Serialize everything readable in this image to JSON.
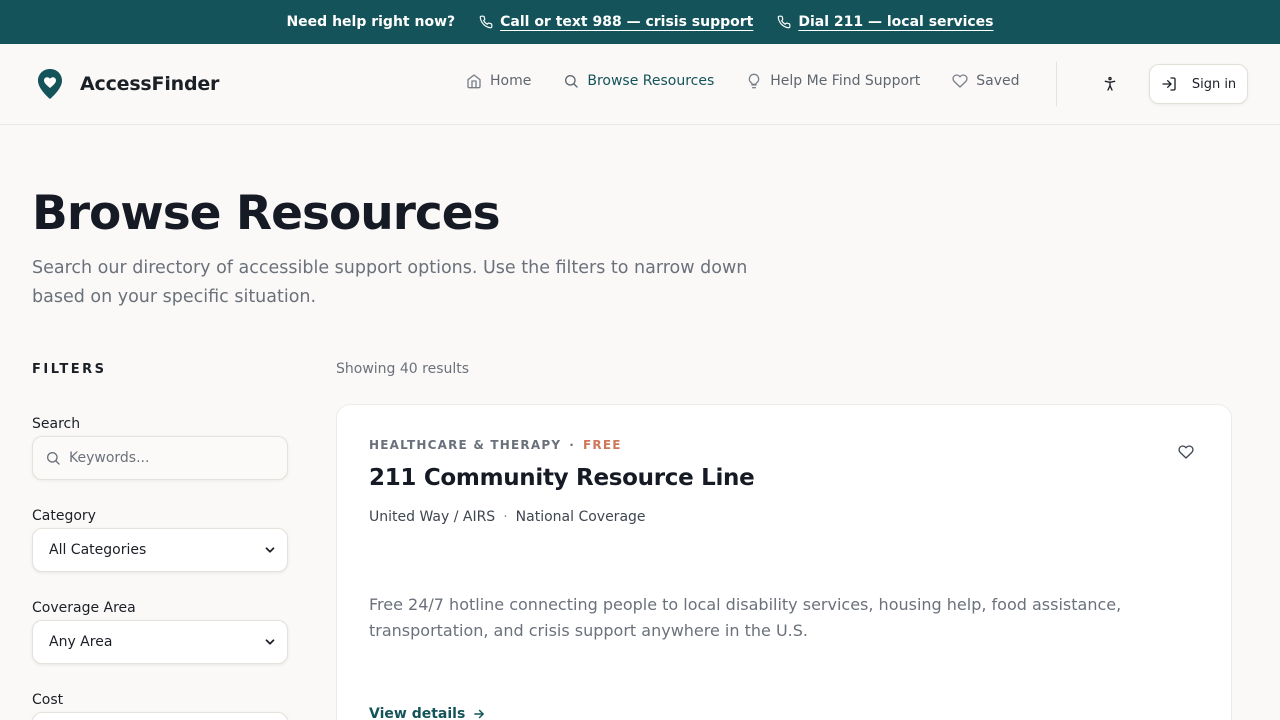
{
  "crisis_bar": {
    "lead_text": "Need help right now?",
    "links": [
      {
        "label": "Call or text 988 — crisis support",
        "icon": "phone-icon"
      },
      {
        "label": "Dial 211 — local services",
        "icon": "phone-icon"
      }
    ]
  },
  "header": {
    "brand_name": "AccessFinder",
    "logo_icon": "map-pin-icon",
    "nav": [
      {
        "label": "Home",
        "icon": "home-icon",
        "active": false
      },
      {
        "label": "Browse Resources",
        "icon": "search-icon",
        "active": true
      },
      {
        "label": "Help Me Find Support",
        "icon": "lightbulb-icon",
        "active": false
      },
      {
        "label": "Saved",
        "icon": "heart-icon",
        "active": false
      }
    ],
    "accessibility_icon": "accessibility-icon",
    "signin_label": "Sign in",
    "signin_icon": "sign-in-icon"
  },
  "hero": {
    "title": "Browse Resources",
    "subtitle": "Search our directory of accessible support options. Use the filters to narrow down based on your specific situation."
  },
  "filters": {
    "heading": "FILTERS",
    "search": {
      "label": "Search",
      "placeholder": "Keywords...",
      "value": ""
    },
    "category": {
      "label": "Category",
      "selected": "All Categories"
    },
    "coverage": {
      "label": "Coverage Area",
      "selected": "Any Area"
    },
    "cost": {
      "label": "Cost"
    }
  },
  "results": {
    "count_text": "Showing 40 results",
    "items": [
      {
        "category": "HEALTHCARE & THERAPY",
        "cost_badge": "FREE",
        "title": "211 Community Resource Line",
        "provider": "United Way / AIRS",
        "coverage": "National Coverage",
        "description": "Free 24/7 hotline connecting people to local disability services, housing help, food assistance, transportation, and crisis support anywhere in the U.S.",
        "link_label": "View details"
      }
    ]
  },
  "colors": {
    "brand_teal": "#14535a",
    "free_badge": "#d0775a",
    "page_bg": "#faf9f7"
  }
}
